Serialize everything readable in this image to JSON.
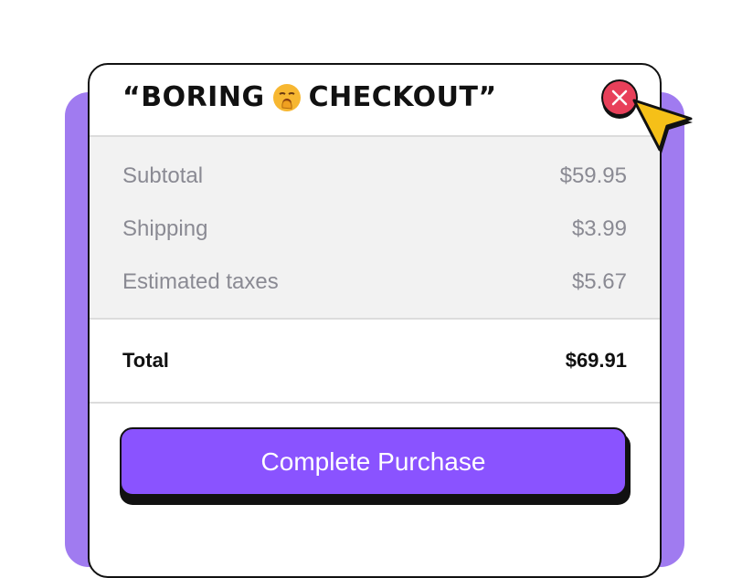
{
  "dialog": {
    "title_open_quote": "“BORING",
    "title_close": "CHECKOUT”",
    "title_emoji": "yawning-face-icon"
  },
  "summary": {
    "rows": [
      {
        "label": "Subtotal",
        "value": "$59.95"
      },
      {
        "label": "Shipping",
        "value": "$3.99"
      },
      {
        "label": "Estimated taxes",
        "value": "$5.67"
      }
    ]
  },
  "total": {
    "label": "Total",
    "value": "$69.91"
  },
  "actions": {
    "complete_label": "Complete Purchase"
  },
  "colors": {
    "accent": "#8a53ff",
    "backdrop": "#a07bf0",
    "close": "#e8405a",
    "cursor": "#f5c018"
  }
}
